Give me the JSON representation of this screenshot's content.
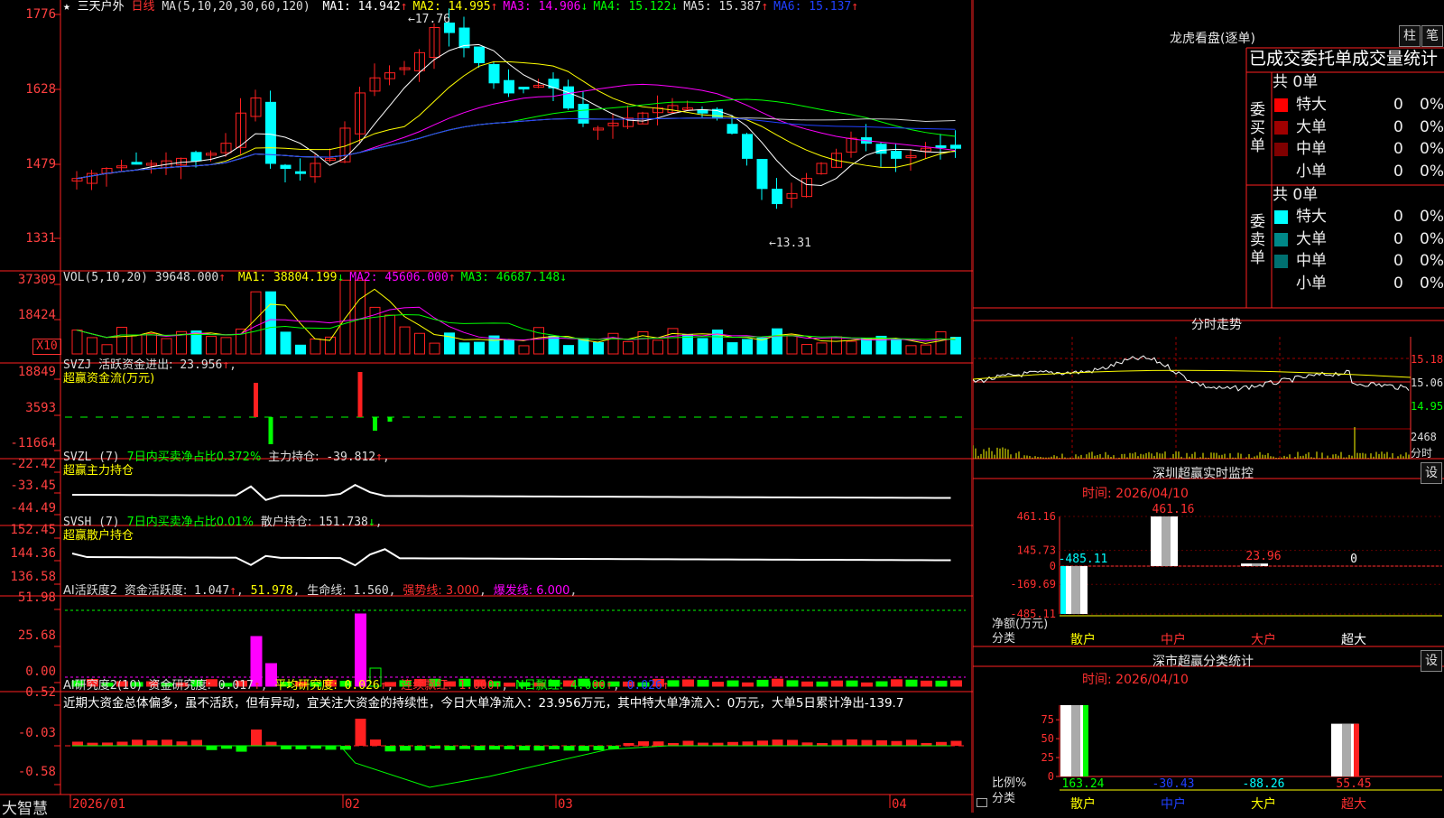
{
  "stock": {
    "star": "★",
    "name": "三天户外",
    "period": "日线"
  },
  "ma_header": {
    "params": "MA(5,10,20,30,60,120)",
    "items": [
      {
        "label": "MA1:",
        "value": "14.942",
        "arrow": "↑",
        "color": "#ffffff"
      },
      {
        "label": "MA2:",
        "value": "14.995",
        "arrow": "↑",
        "color": "#ffff00"
      },
      {
        "label": "MA3:",
        "value": "14.906",
        "arrow": "↓",
        "color": "#ff00ff"
      },
      {
        "label": "MA4:",
        "value": "15.122",
        "arrow": "↓",
        "color": "#00ff00"
      },
      {
        "label": "MA5:",
        "value": "15.387",
        "arrow": "↑",
        "color": "#dddddd"
      },
      {
        "label": "MA6:",
        "value": "15.137",
        "arrow": "↑",
        "color": "#2040ff"
      }
    ]
  },
  "price_axis": [
    "1776",
    "1628",
    "1479",
    "1331"
  ],
  "annot_high": "17.76",
  "annot_low": "13.31",
  "vol_header": {
    "label": "VOL(5,10,20)",
    "value": "39648.000",
    "arrow": "↑",
    "items": [
      {
        "label": "MA1:",
        "value": "38804.199",
        "arrow": "↓",
        "color": "#ffff00"
      },
      {
        "label": "MA2:",
        "value": "45606.000",
        "arrow": "↑",
        "color": "#ff00ff"
      },
      {
        "label": "MA3:",
        "value": "46687.148",
        "arrow": "↓",
        "color": "#00ff00"
      }
    ]
  },
  "vol_axis": [
    "37309",
    "18424"
  ],
  "vol_unit": "X10",
  "svzj": {
    "code": "SVZJ",
    "label": "活跃资金进出:",
    "value": "23.956",
    "arrow": "↑",
    "sub": "超赢资金流(万元)",
    "axis": [
      "18849",
      "3593",
      "-11664"
    ]
  },
  "svzl": {
    "code": "SVZL (7)",
    "ratio": "7日内买卖净占比0.372%",
    "label": "主力持仓:",
    "value": "-39.812",
    "arrow": "↑",
    "sub": "超赢主力持仓",
    "axis": [
      "-22.42",
      "-33.45",
      "-44.49"
    ]
  },
  "svsh": {
    "code": "SVSH (7)",
    "ratio": "7日内买卖净占比0.01%",
    "label": "散户持仓:",
    "value": "151.738",
    "arrow": "↓",
    "sub": "超赢散户持仓",
    "axis": [
      "152.45",
      "144.36",
      "136.58"
    ]
  },
  "ai2": {
    "code": "AI活跃度2",
    "label": "资金活跃度:",
    "value": "1.047",
    "v2": "51.978",
    "life_label": "生命线:",
    "life": "1.560",
    "strong": "强势线: 3.000",
    "burst": "爆发线: 6.000",
    "axis": [
      "51.98",
      "25.68",
      "0.00"
    ]
  },
  "ai_r": {
    "code": "AI研究度2(10)",
    "l1": "资金研究度:",
    "v1": "0.017",
    "l2": "平均研究度:",
    "v2": "0.026",
    "l3": "连续飘红:",
    "v3": "1.000",
    "l4": "N日飘红:",
    "v4": "4.000",
    "v5": "0.026",
    "desc": "近期大资金总体偏多，虽不活跃，但有异动，宜关注大资金的持续性，今日大单净流入：23.956万元，其中特大单净流入：0万元，大单5日累计净出-139.7",
    "axis": [
      "0.52",
      "-0.03",
      "-0.58"
    ]
  },
  "date_axis": [
    "2026/01",
    "02",
    "03",
    "04"
  ],
  "brand": "大智慧",
  "right": {
    "lhb_title": "龙虎看盘(逐单)",
    "btn_zhu": "柱",
    "btn_bi": "笔",
    "order_title": "已成交委托单成交量统计",
    "buy_label": "委买单",
    "sell_label": "委卖单",
    "buy_total": "共 0单",
    "sell_total": "共 0单",
    "buy_rows": [
      {
        "name": "特大",
        "val": "0",
        "pct": "0%",
        "color": "#ff0000"
      },
      {
        "name": "大单",
        "val": "0",
        "pct": "0%",
        "color": "#a00000"
      },
      {
        "name": "中单",
        "val": "0",
        "pct": "0%",
        "color": "#800000"
      },
      {
        "name": "小单",
        "val": "0",
        "pct": "0%",
        "color": ""
      }
    ],
    "sell_rows": [
      {
        "name": "特大",
        "val": "0",
        "pct": "0%",
        "color": "#00ffff"
      },
      {
        "name": "大单",
        "val": "0",
        "pct": "0%",
        "color": "#008888"
      },
      {
        "name": "中单",
        "val": "0",
        "pct": "0%",
        "color": "#007070"
      },
      {
        "name": "小单",
        "val": "0",
        "pct": "0%",
        "color": ""
      }
    ],
    "intraday_title": "分时走势",
    "intraday_axis": [
      "15.18",
      "15.06",
      "14.95"
    ],
    "intraday_vol": "2468",
    "intraday_unit": "分时",
    "sz_title": "深圳超赢实时监控",
    "sz_set": "设",
    "sz_time": "时间: 2026/04/10",
    "sz_axis": [
      "461.16",
      "145.73",
      "0",
      "-169.69",
      "-485.11"
    ],
    "sz_bars": [
      {
        "cat": "散户",
        "value": "-485.11"
      },
      {
        "cat": "中户",
        "value": "461.16"
      },
      {
        "cat": "大户",
        "value": "23.96"
      },
      {
        "cat": "超大",
        "value": "0"
      }
    ],
    "sz_ylabel": "净额(万元)",
    "sz_xlabel": "分类",
    "cls_title": "深市超赢分类统计",
    "cls_set": "设",
    "cls_time": "时间: 2026/04/10",
    "cls_axis": [
      "75",
      "50",
      "25",
      "0"
    ],
    "cls_bars": [
      {
        "cat": "散户",
        "value": "163.24"
      },
      {
        "cat": "中户",
        "value": "-30.43"
      },
      {
        "cat": "大户",
        "value": "-88.26"
      },
      {
        "cat": "超大",
        "value": "55.45"
      }
    ],
    "cls_ylabel": "比例%",
    "cls_xlabel": "分类"
  }
}
